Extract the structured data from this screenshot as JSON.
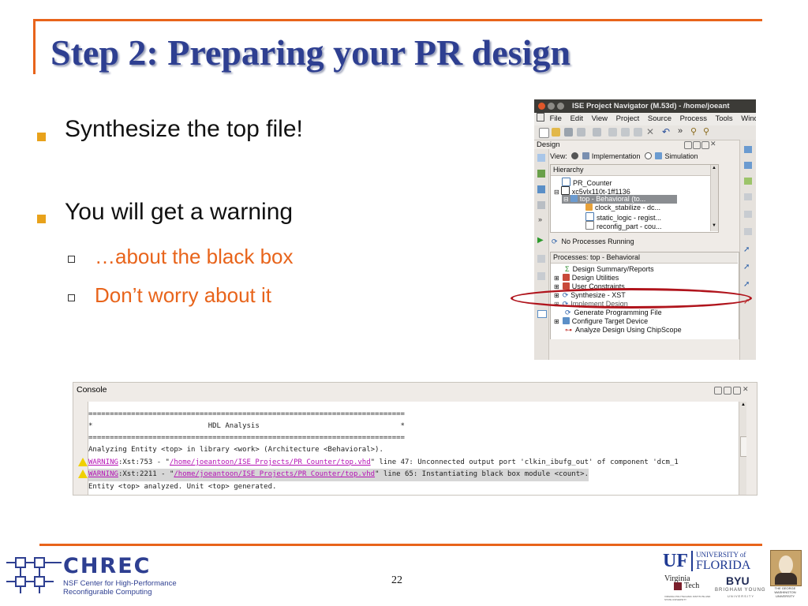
{
  "slide": {
    "title": "Step 2: Preparing your PR design",
    "bullets": [
      {
        "text": "Synthesize the top file!"
      },
      {
        "text": "You will get a warning",
        "sub": [
          "…about the black box",
          "Don’t worry about it"
        ]
      }
    ],
    "page_number": "22"
  },
  "ise": {
    "window_title": "ISE Project Navigator (M.53d) - /home/joeant",
    "menu": [
      "File",
      "Edit",
      "View",
      "Project",
      "Source",
      "Process",
      "Tools",
      "Window"
    ],
    "design_label": "Design",
    "view_label": "View:",
    "view_options": [
      "Implementation",
      "Simulation"
    ],
    "hierarchy_label": "Hierarchy",
    "hierarchy_items": [
      "PR_Counter",
      "xc5vlx110t-1ff1136",
      "top - Behavioral (to...",
      "clock_stabilize - dc...",
      "static_logic - regist...",
      "reconfig_part - cou..."
    ],
    "status": "No Processes Running",
    "processes_label": "Processes: top - Behavioral",
    "process_items": [
      "Design Summary/Reports",
      "Design Utilities",
      "User Constraints",
      "Synthesize - XST",
      "Implement Design",
      "Generate Programming File",
      "Configure Target Device",
      "Analyze Design Using ChipScope"
    ]
  },
  "console": {
    "title": "Console",
    "separator": "==========================================================================",
    "heading_line": "*                           HDL Analysis                                 *",
    "analyzing": "Analyzing Entity <top> in library <work> (Architecture <Behavioral>).",
    "warnings": [
      {
        "label": "WARNING",
        "code": ":Xst:753 - \"",
        "path": "/home/joeantoon/ISE_Projects/PR_Counter/top.vhd",
        "rest": "\" line 47: Unconnected output port 'clkin_ibufg_out' of component 'dcm_1"
      },
      {
        "label": "WARNING",
        "code": ":Xst:2211 - \"",
        "path": "/home/joeantoon/ISE_Projects/PR_Counter/top.vhd",
        "rest": "\" line 65: Instantiating black box module <count>."
      }
    ],
    "done": "Entity <top> analyzed. Unit <top> generated."
  },
  "footer": {
    "chrec_name": "CHREC",
    "chrec_line1": "NSF Center for High-Performance",
    "chrec_line2": "Reconfigurable Computing",
    "uf": "UF",
    "uf_line1": "UNIVERSITY of",
    "uf_line2": "FLORIDA",
    "vt_line1": "Virginia",
    "vt_line2": "Tech",
    "vt_small": "VIRGINIA POLYTECHNIC INSTITUTE AND STATE UNIVERSITY",
    "byu": "BYU",
    "byu_line": "BRIGHAM YOUNG",
    "byu_small": "UNIVERSITY",
    "gw_line1": "THE GEORGE",
    "gw_line2": "WASHINGTON",
    "gw_line3": "UNIVERSITY"
  },
  "colors": {
    "accent": "#e8641b",
    "title": "#2e3f91",
    "bullet": "#e8a21b",
    "highlight_ellipse": "#b0141c"
  }
}
